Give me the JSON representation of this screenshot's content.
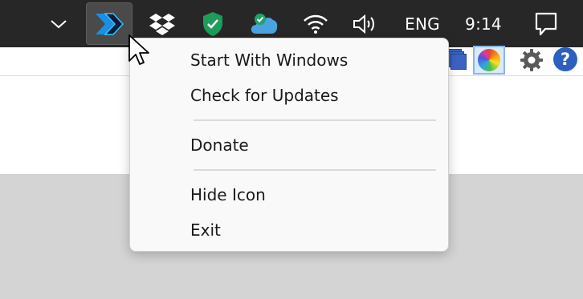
{
  "taskbar": {
    "chevron_icon": "chevron-up-icon",
    "language": "ENG",
    "time": "9:14",
    "icons": [
      "app-chevron-logo-icon",
      "dropbox-icon",
      "security-shield-icon",
      "cloud-sync-icon",
      "wifi-icon",
      "volume-icon",
      "notification-icon"
    ]
  },
  "context_menu": {
    "items": [
      {
        "label": "Start With Windows"
      },
      {
        "label": "Check for Updates"
      },
      {
        "label": "Donate"
      },
      {
        "label": "Hide Icon"
      },
      {
        "label": "Exit"
      }
    ]
  },
  "app_toolbar": {
    "icons": [
      "layers-icon",
      "color-wheel-icon",
      "gear-icon",
      "help-icon"
    ],
    "help_glyph": "?"
  },
  "colors": {
    "taskbar_bg": "#272727",
    "menu_bg": "#f9f9f9",
    "shield_green": "#1e9c5a",
    "cloud_blue": "#4aa3df"
  }
}
